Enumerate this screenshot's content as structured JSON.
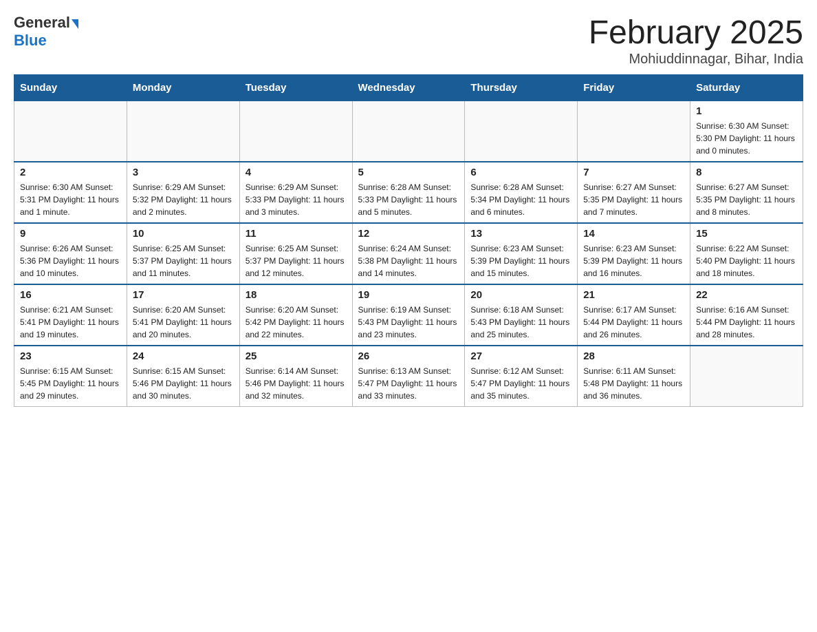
{
  "logo": {
    "general": "General",
    "blue": "Blue"
  },
  "title": "February 2025",
  "subtitle": "Mohiuddinnagar, Bihar, India",
  "days_of_week": [
    "Sunday",
    "Monday",
    "Tuesday",
    "Wednesday",
    "Thursday",
    "Friday",
    "Saturday"
  ],
  "weeks": [
    [
      {
        "day": "",
        "info": ""
      },
      {
        "day": "",
        "info": ""
      },
      {
        "day": "",
        "info": ""
      },
      {
        "day": "",
        "info": ""
      },
      {
        "day": "",
        "info": ""
      },
      {
        "day": "",
        "info": ""
      },
      {
        "day": "1",
        "info": "Sunrise: 6:30 AM\nSunset: 5:30 PM\nDaylight: 11 hours and 0 minutes."
      }
    ],
    [
      {
        "day": "2",
        "info": "Sunrise: 6:30 AM\nSunset: 5:31 PM\nDaylight: 11 hours and 1 minute."
      },
      {
        "day": "3",
        "info": "Sunrise: 6:29 AM\nSunset: 5:32 PM\nDaylight: 11 hours and 2 minutes."
      },
      {
        "day": "4",
        "info": "Sunrise: 6:29 AM\nSunset: 5:33 PM\nDaylight: 11 hours and 3 minutes."
      },
      {
        "day": "5",
        "info": "Sunrise: 6:28 AM\nSunset: 5:33 PM\nDaylight: 11 hours and 5 minutes."
      },
      {
        "day": "6",
        "info": "Sunrise: 6:28 AM\nSunset: 5:34 PM\nDaylight: 11 hours and 6 minutes."
      },
      {
        "day": "7",
        "info": "Sunrise: 6:27 AM\nSunset: 5:35 PM\nDaylight: 11 hours and 7 minutes."
      },
      {
        "day": "8",
        "info": "Sunrise: 6:27 AM\nSunset: 5:35 PM\nDaylight: 11 hours and 8 minutes."
      }
    ],
    [
      {
        "day": "9",
        "info": "Sunrise: 6:26 AM\nSunset: 5:36 PM\nDaylight: 11 hours and 10 minutes."
      },
      {
        "day": "10",
        "info": "Sunrise: 6:25 AM\nSunset: 5:37 PM\nDaylight: 11 hours and 11 minutes."
      },
      {
        "day": "11",
        "info": "Sunrise: 6:25 AM\nSunset: 5:37 PM\nDaylight: 11 hours and 12 minutes."
      },
      {
        "day": "12",
        "info": "Sunrise: 6:24 AM\nSunset: 5:38 PM\nDaylight: 11 hours and 14 minutes."
      },
      {
        "day": "13",
        "info": "Sunrise: 6:23 AM\nSunset: 5:39 PM\nDaylight: 11 hours and 15 minutes."
      },
      {
        "day": "14",
        "info": "Sunrise: 6:23 AM\nSunset: 5:39 PM\nDaylight: 11 hours and 16 minutes."
      },
      {
        "day": "15",
        "info": "Sunrise: 6:22 AM\nSunset: 5:40 PM\nDaylight: 11 hours and 18 minutes."
      }
    ],
    [
      {
        "day": "16",
        "info": "Sunrise: 6:21 AM\nSunset: 5:41 PM\nDaylight: 11 hours and 19 minutes."
      },
      {
        "day": "17",
        "info": "Sunrise: 6:20 AM\nSunset: 5:41 PM\nDaylight: 11 hours and 20 minutes."
      },
      {
        "day": "18",
        "info": "Sunrise: 6:20 AM\nSunset: 5:42 PM\nDaylight: 11 hours and 22 minutes."
      },
      {
        "day": "19",
        "info": "Sunrise: 6:19 AM\nSunset: 5:43 PM\nDaylight: 11 hours and 23 minutes."
      },
      {
        "day": "20",
        "info": "Sunrise: 6:18 AM\nSunset: 5:43 PM\nDaylight: 11 hours and 25 minutes."
      },
      {
        "day": "21",
        "info": "Sunrise: 6:17 AM\nSunset: 5:44 PM\nDaylight: 11 hours and 26 minutes."
      },
      {
        "day": "22",
        "info": "Sunrise: 6:16 AM\nSunset: 5:44 PM\nDaylight: 11 hours and 28 minutes."
      }
    ],
    [
      {
        "day": "23",
        "info": "Sunrise: 6:15 AM\nSunset: 5:45 PM\nDaylight: 11 hours and 29 minutes."
      },
      {
        "day": "24",
        "info": "Sunrise: 6:15 AM\nSunset: 5:46 PM\nDaylight: 11 hours and 30 minutes."
      },
      {
        "day": "25",
        "info": "Sunrise: 6:14 AM\nSunset: 5:46 PM\nDaylight: 11 hours and 32 minutes."
      },
      {
        "day": "26",
        "info": "Sunrise: 6:13 AM\nSunset: 5:47 PM\nDaylight: 11 hours and 33 minutes."
      },
      {
        "day": "27",
        "info": "Sunrise: 6:12 AM\nSunset: 5:47 PM\nDaylight: 11 hours and 35 minutes."
      },
      {
        "day": "28",
        "info": "Sunrise: 6:11 AM\nSunset: 5:48 PM\nDaylight: 11 hours and 36 minutes."
      },
      {
        "day": "",
        "info": ""
      }
    ]
  ]
}
